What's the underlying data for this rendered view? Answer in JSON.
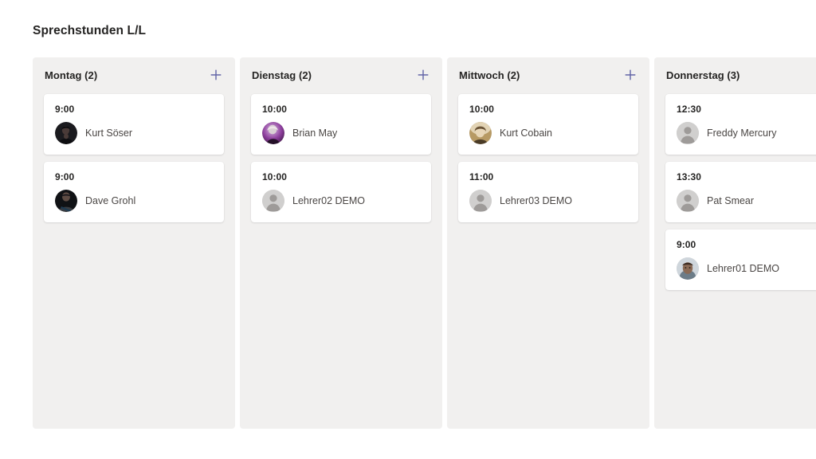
{
  "page": {
    "title": "Sprechstunden L/L",
    "background": "#ffffff"
  },
  "theme": {
    "column_background": "#F1F0EF",
    "card_background": "#FFFFFF",
    "accent": "#6264A7",
    "title_color": "#252423",
    "name_color": "#4A4644",
    "generic_avatar_bg": "#D0CFCE",
    "generic_avatar_fg": "#9E9B99"
  },
  "board": {
    "add_icon": "plus-icon",
    "columns": [
      {
        "id": "montag",
        "title": "Montag (2)",
        "day": "Montag",
        "count": 2,
        "add_label": "+",
        "cards": [
          {
            "time": "9:00",
            "name": "Kurt Söser",
            "avatar_type": "photo",
            "avatar_icon": "avatar-photo-kurt-soeser",
            "avatar_colors": [
              "#1b1b1f",
              "#4a3b38",
              "#0d0d10"
            ]
          },
          {
            "time": "9:00",
            "name": "Dave Grohl",
            "avatar_type": "photo",
            "avatar_icon": "avatar-photo-dave-grohl",
            "avatar_colors": [
              "#101215",
              "#3a3d42",
              "#1d3b52"
            ]
          }
        ]
      },
      {
        "id": "dienstag",
        "title": "Dienstag (2)",
        "day": "Dienstag",
        "count": 2,
        "add_label": "+",
        "cards": [
          {
            "time": "10:00",
            "name": "Brian May",
            "avatar_type": "photo",
            "avatar_icon": "avatar-photo-brian-may",
            "avatar_colors": [
              "#8e3f9e",
              "#d7b9df",
              "#3a1640"
            ]
          },
          {
            "time": "10:00",
            "name": "Lehrer02 DEMO",
            "avatar_type": "generic",
            "avatar_icon": "generic-person-icon",
            "avatar_colors": [
              "#D0CFCE",
              "#9E9B99"
            ]
          }
        ]
      },
      {
        "id": "mittwoch",
        "title": "Mittwoch (2)",
        "day": "Mittwoch",
        "count": 2,
        "add_label": "+",
        "cards": [
          {
            "time": "10:00",
            "name": "Kurt Cobain",
            "avatar_type": "photo",
            "avatar_icon": "avatar-photo-kurt-cobain",
            "avatar_colors": [
              "#b79a64",
              "#6a5336",
              "#e2d3b4"
            ]
          },
          {
            "time": "11:00",
            "name": "Lehrer03 DEMO",
            "avatar_type": "generic",
            "avatar_icon": "generic-person-icon",
            "avatar_colors": [
              "#D0CFCE",
              "#9E9B99"
            ]
          }
        ]
      },
      {
        "id": "donnerstag",
        "title": "Donnerstag (3)",
        "day": "Donnerstag",
        "count": 3,
        "add_label": "+",
        "cards": [
          {
            "time": "12:30",
            "name": "Freddy Mercury",
            "avatar_type": "generic",
            "avatar_icon": "generic-person-icon",
            "avatar_colors": [
              "#D0CFCE",
              "#9E9B99"
            ]
          },
          {
            "time": "13:30",
            "name": "Pat Smear",
            "avatar_type": "generic",
            "avatar_icon": "generic-person-icon",
            "avatar_colors": [
              "#D0CFCE",
              "#9E9B99"
            ]
          },
          {
            "time": "9:00",
            "name": "Lehrer01 DEMO",
            "avatar_type": "photo",
            "avatar_icon": "avatar-photo-lehrer01-demo",
            "avatar_colors": [
              "#cfd6dc",
              "#8a6a55",
              "#3b2a20"
            ]
          }
        ]
      }
    ]
  }
}
